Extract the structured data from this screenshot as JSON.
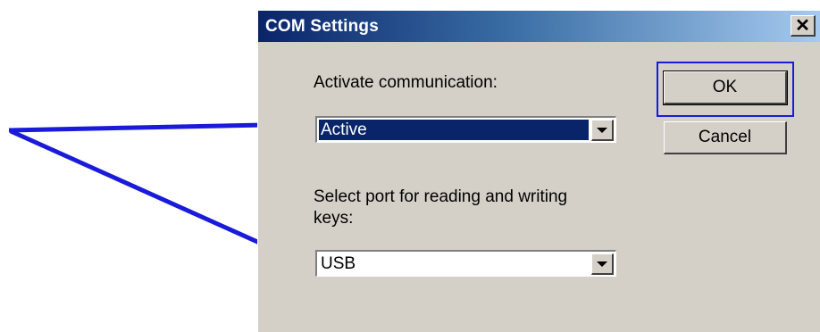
{
  "dialog": {
    "title": "COM Settings",
    "close_glyph": "✕",
    "activate_label": "Activate communication:",
    "activate_value": "Active",
    "port_label_line1": "Select port for reading and writing",
    "port_label_line2": "keys:",
    "port_value": "USB",
    "ok_label": "OK",
    "cancel_label": "Cancel"
  },
  "colors": {
    "title_start": "#0a246a",
    "title_end": "#a6caf0",
    "dialog_bg": "#d4d0c8",
    "selection_bg": "#0a246a",
    "annotation_arrow": "#1a1adb"
  },
  "icons": [
    "close-icon",
    "dropdown-arrow-icon",
    "annotation-arrow-icon"
  ]
}
